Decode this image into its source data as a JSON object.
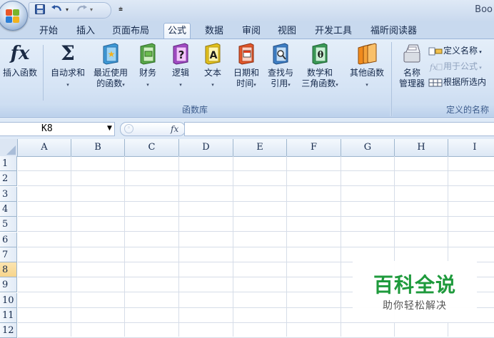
{
  "titlebar": {
    "title": "Boo"
  },
  "tabs": [
    {
      "label": "开始"
    },
    {
      "label": "插入"
    },
    {
      "label": "页面布局"
    },
    {
      "label": "公式"
    },
    {
      "label": "数据"
    },
    {
      "label": "审阅"
    },
    {
      "label": "视图"
    },
    {
      "label": "开发工具"
    },
    {
      "label": "福昕阅读器"
    }
  ],
  "active_tab": "公式",
  "ribbon": {
    "function_library": {
      "group_label": "函数库",
      "insert_function": {
        "icon": "fx-icon",
        "line1": "插入函数",
        "glyph": "fx"
      },
      "autosum": {
        "icon": "sigma-icon",
        "line1": "自动求和",
        "glyph": "Σ"
      },
      "recent": {
        "icon": "book-star-icon",
        "line1": "最近使用",
        "line2": "的函数"
      },
      "financial": {
        "icon": "book-money-icon",
        "line1": "财务"
      },
      "logical": {
        "icon": "book-question-icon",
        "line1": "逻辑",
        "glyph": "?"
      },
      "text": {
        "icon": "book-a-icon",
        "line1": "文本",
        "glyph": "A"
      },
      "datetime": {
        "icon": "book-calendar-icon",
        "line1": "日期和",
        "line2": "时间"
      },
      "lookup": {
        "icon": "book-magnifier-icon",
        "line1": "查找与",
        "line2": "引用"
      },
      "math": {
        "icon": "book-theta-icon",
        "line1": "数学和",
        "line2": "三角函数",
        "glyph": "θ"
      },
      "more": {
        "icon": "books-stack-icon",
        "line1": "其他函数"
      }
    },
    "defined_names": {
      "group_label": "定义的名称",
      "name_manager": {
        "icon": "name-manager-icon",
        "line1": "名称",
        "line2": "管理器"
      },
      "define_name": {
        "icon": "define-name-icon",
        "label": "定义名称"
      },
      "use_in_formula": {
        "icon": "use-in-formula-icon",
        "label": "用于公式"
      },
      "create_from_selection": {
        "icon": "create-from-selection-icon",
        "label": "根据所选内"
      }
    }
  },
  "formula_bar": {
    "name_box": "K8",
    "fx_label": "fx",
    "formula": ""
  },
  "grid": {
    "columns": [
      "A",
      "B",
      "C",
      "D",
      "E",
      "F",
      "G",
      "H",
      "I"
    ],
    "rows": [
      "1",
      "2",
      "3",
      "4",
      "5",
      "6",
      "7",
      "8",
      "9",
      "10",
      "11",
      "12"
    ],
    "selected_row": "8"
  },
  "watermark": {
    "title": "百科全说",
    "subtitle": "助你轻松解决"
  },
  "colors": {
    "accent": "#c8d9ee",
    "selected_row": "#f7d58c",
    "watermark_green": "#1e9a3c"
  }
}
